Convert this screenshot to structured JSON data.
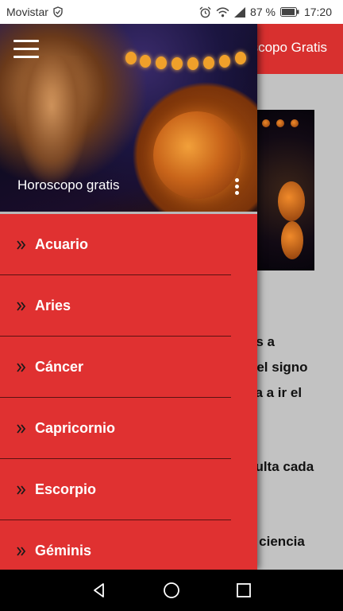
{
  "status_bar": {
    "carrier": "Movistar",
    "battery": "87 %",
    "time": "17:20"
  },
  "background": {
    "toolbar_title": "scopo Gratis",
    "text_lines": [
      "tis a",
      "r el signo",
      "va a ir el",
      "sulta cada",
      "a ciencia"
    ]
  },
  "drawer": {
    "header_title": "Horoscopo gratis",
    "items": [
      {
        "label": "Acuario"
      },
      {
        "label": "Aries"
      },
      {
        "label": "Cáncer"
      },
      {
        "label": "Capricornio"
      },
      {
        "label": "Escorpio"
      },
      {
        "label": "Géminis"
      }
    ]
  },
  "colors": {
    "accent": "#e03131",
    "toolbar": "#d8302f"
  }
}
